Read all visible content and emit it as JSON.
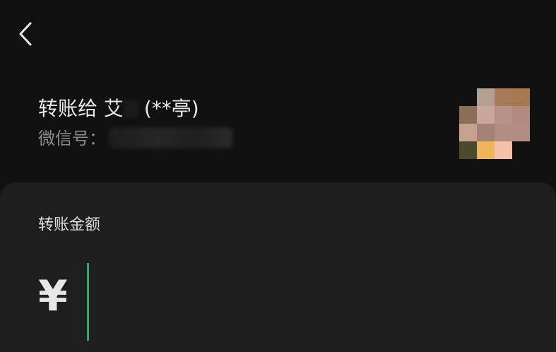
{
  "header": {
    "back_icon": "chevron-left-icon"
  },
  "recipient": {
    "title_prefix": "转账给 艾",
    "title_suffix": "(**亭)",
    "wechat_id_label": "微信号："
  },
  "amount": {
    "label": "转账金额",
    "currency_symbol": "¥",
    "value": ""
  },
  "colors": {
    "background": "#111111",
    "panel": "#1e1e1e",
    "accent_cursor": "#07c160",
    "secondary_text": "#8c8c8c"
  }
}
